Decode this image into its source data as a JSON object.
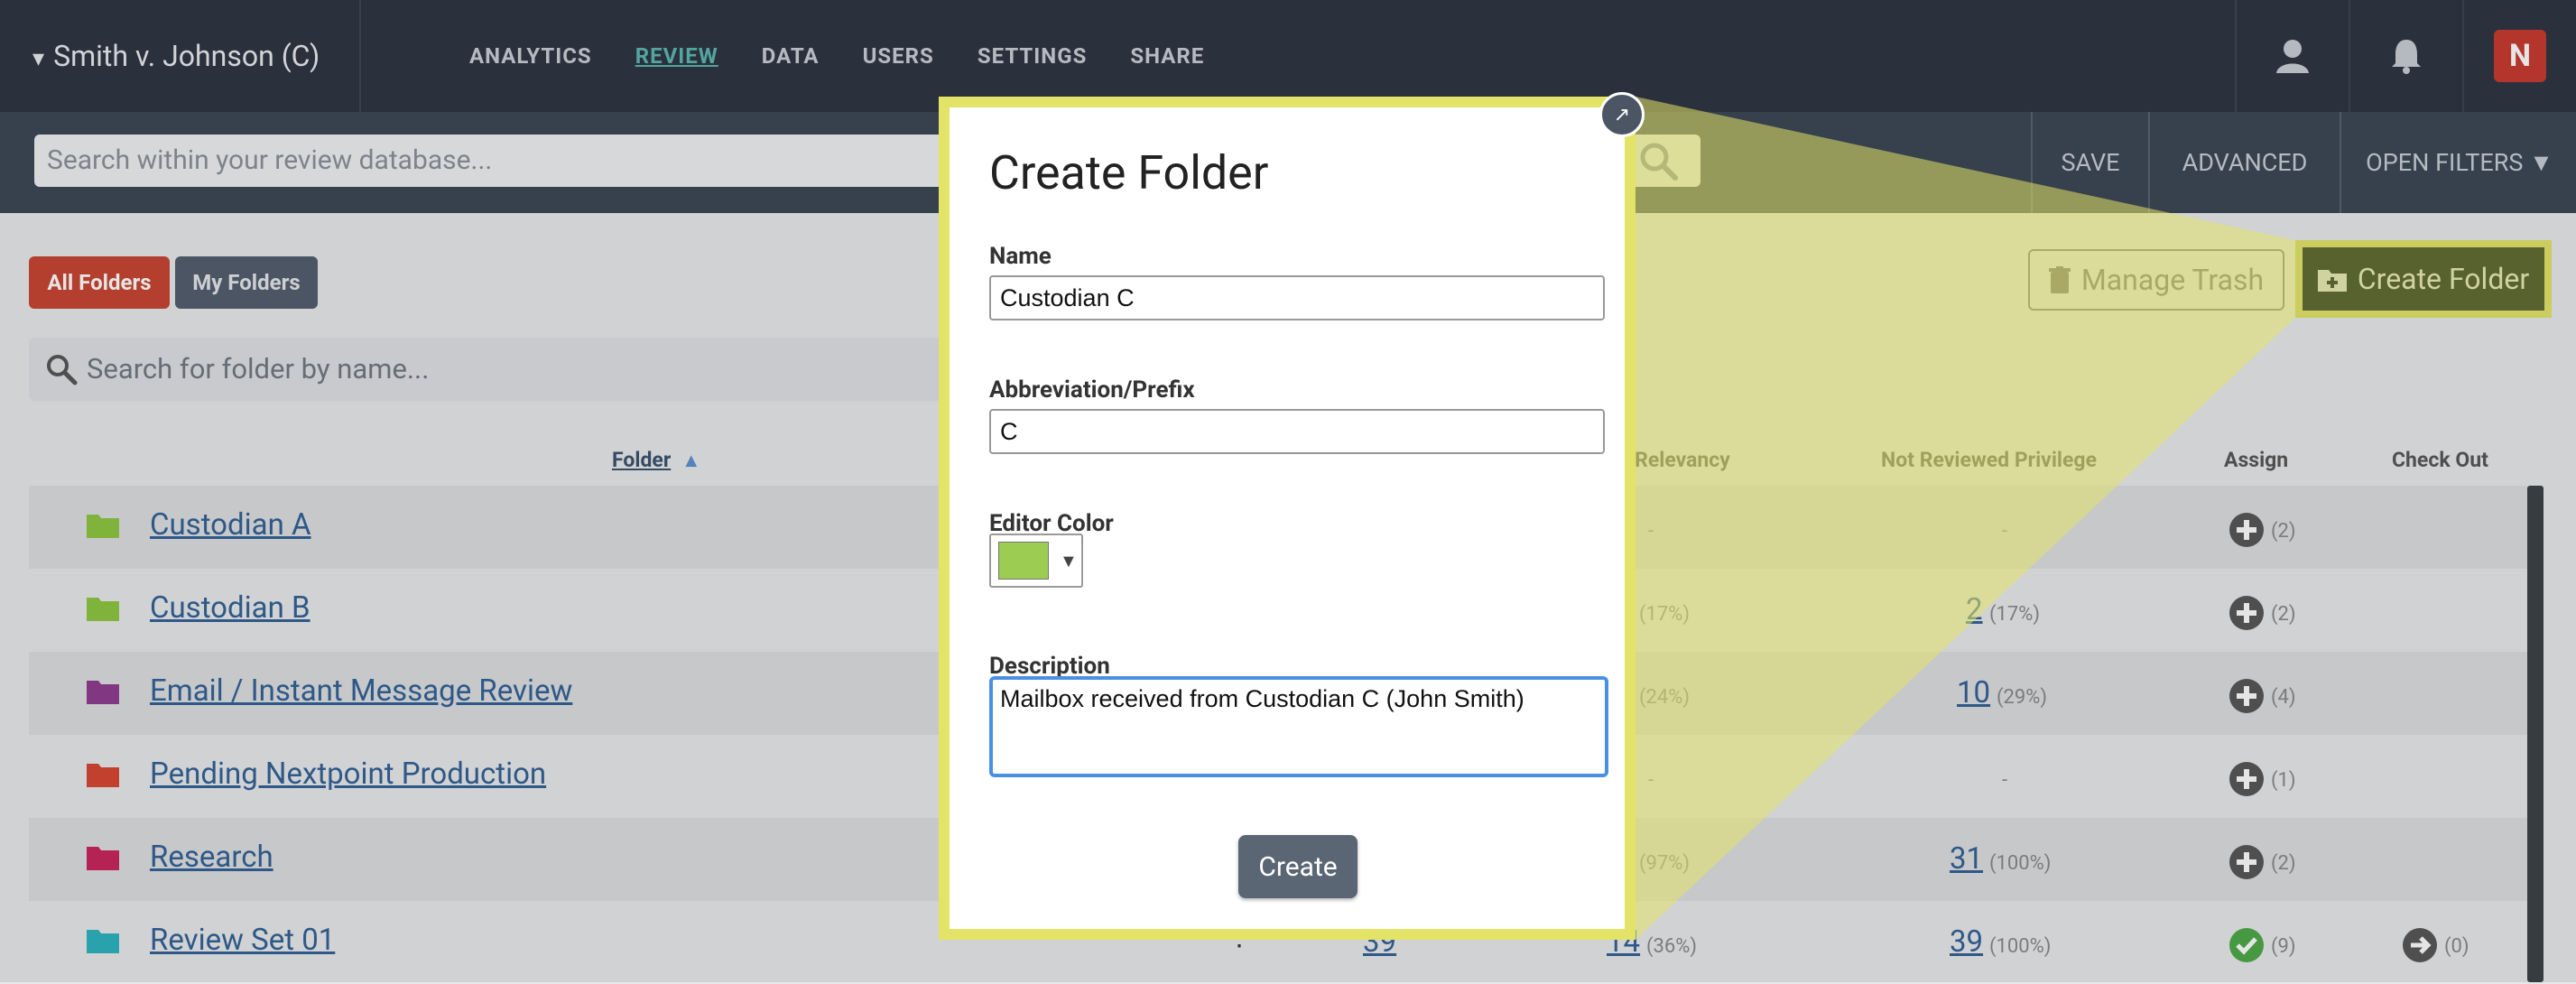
{
  "topbar": {
    "matter_title": "Smith v. Johnson (C)",
    "nav": [
      "ANALYTICS",
      "REVIEW",
      "DATA",
      "USERS",
      "SETTINGS",
      "SHARE"
    ],
    "active_nav": "REVIEW"
  },
  "search": {
    "placeholder": "Search within your review database...",
    "save_label": "SAVE",
    "advanced_label": "ADVANCED",
    "open_filters_label": "OPEN FILTERS ▼"
  },
  "folders_page": {
    "all_folders_label": "All Folders",
    "my_folders_label": "My Folders",
    "folder_search_placeholder": "Search for folder by name...",
    "manage_trash_label": "Manage Trash",
    "create_folder_label": "Create Folder",
    "columns": {
      "folder": "Folder",
      "relevancy": "ed Relevancy",
      "privilege": "Not Reviewed Privilege",
      "assign": "Assign",
      "checkout": "Check Out"
    },
    "rows": [
      {
        "name": "Custodian A",
        "folder_color": "#8cc63f",
        "relevancy": "-",
        "relevancy_pct": "",
        "privilege": "-",
        "privilege_pct": "",
        "assign_count": "(2)",
        "checkout": ""
      },
      {
        "name": "Custodian B",
        "folder_color": "#8cc63f",
        "relevancy": "",
        "relevancy_pct": "(17%)",
        "privilege": "2",
        "privilege_pct": "(17%)",
        "assign_count": "(2)",
        "checkout": ""
      },
      {
        "name": "Email / Instant Message Review",
        "folder_color": "#8e3a8e",
        "relevancy": "",
        "relevancy_pct": "(24%)",
        "privilege": "10",
        "privilege_pct": "(29%)",
        "assign_count": "(4)",
        "checkout": ""
      },
      {
        "name": "Pending Nextpoint Production",
        "folder_color": "#d6452f",
        "relevancy": "-",
        "relevancy_pct": "",
        "privilege": "-",
        "privilege_pct": "",
        "assign_count": "(1)",
        "checkout": ""
      },
      {
        "name": "Research",
        "folder_color": "#c8235a",
        "relevancy": "",
        "relevancy_pct": "(97%)",
        "privilege": "31",
        "privilege_pct": "(100%)",
        "assign_count": "(2)",
        "checkout": ""
      },
      {
        "name": "Review Set 01",
        "folder_color": "#2bb3c0",
        "docs": "39",
        "relevancy": "14",
        "relevancy_pct": "(36%)",
        "privilege": "39",
        "privilege_pct": "(100%)",
        "assign_count": "(9)",
        "checkout": "(0)"
      }
    ]
  },
  "modal": {
    "title": "Create Folder",
    "name_label": "Name",
    "name_value": "Custodian C",
    "abbrev_label": "Abbreviation/Prefix",
    "abbrev_value": "C",
    "color_label": "Editor Color",
    "color_value": "#9ccc52",
    "description_label": "Description",
    "description_value": "Mailbox received from Custodian C (John Smith)",
    "create_label": "Create"
  }
}
